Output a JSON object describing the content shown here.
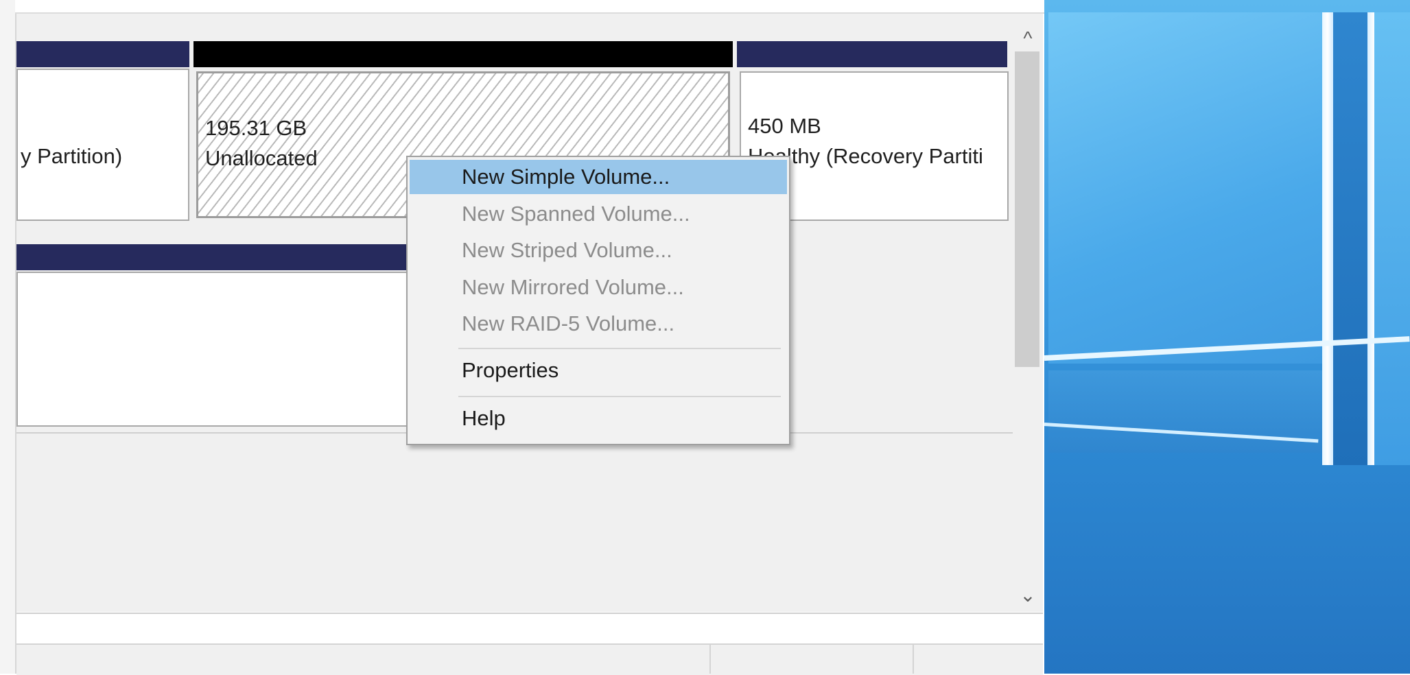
{
  "partitions": {
    "left": {
      "label_partial": "y Partition)"
    },
    "unallocated": {
      "size": "195.31 GB",
      "status": "Unallocated"
    },
    "recovery": {
      "size": "450 MB",
      "status": "Healthy (Recovery Partiti"
    }
  },
  "scrollbar": {
    "up_glyph": "^",
    "down_glyph": "⌄"
  },
  "context_menu": {
    "items": [
      {
        "label": "New Simple Volume...",
        "enabled": true,
        "highlighted": true
      },
      {
        "label": "New Spanned Volume...",
        "enabled": false
      },
      {
        "label": "New Striped Volume...",
        "enabled": false
      },
      {
        "label": "New Mirrored Volume...",
        "enabled": false
      },
      {
        "label": "New RAID-5 Volume...",
        "enabled": false
      },
      {
        "label": "Properties",
        "enabled": true
      },
      {
        "label": "Help",
        "enabled": true
      }
    ]
  },
  "colors": {
    "partition_header_primary": "#262a5d",
    "partition_header_unallocated": "#000000",
    "menu_highlight": "#98c6ea",
    "menu_disabled_text": "#8c8c8c",
    "wallpaper_blue": "#2e8ad4"
  }
}
